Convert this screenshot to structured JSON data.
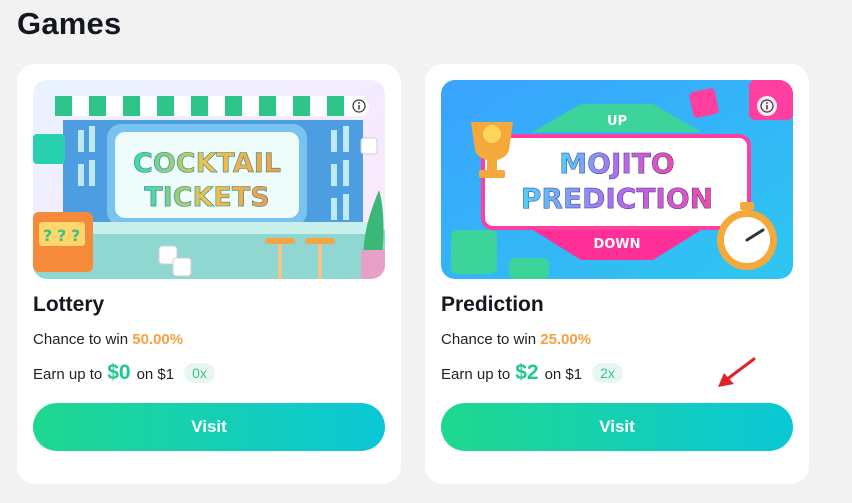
{
  "page": {
    "title": "Games"
  },
  "colors": {
    "accent_orange": "#f5a142",
    "accent_green": "#20c88c",
    "button_gradient_start": "#1fd88f",
    "button_gradient_end": "#0bc7d6",
    "annotation_arrow": "#e0232a"
  },
  "cards": [
    {
      "name": "Lottery",
      "banner_line1": "COCKTAIL",
      "banner_line2": "TICKETS",
      "chance_label": "Chance to win",
      "chance_value": "50.00%",
      "earn_label": "Earn up to",
      "earn_amount": "$0",
      "earn_on": "on $1",
      "multiplier": "0x",
      "button_label": "Visit",
      "info_icon": "info-icon"
    },
    {
      "name": "Prediction",
      "banner_line1": "MOJITO",
      "banner_line2": "PREDICTION",
      "banner_up": "UP",
      "banner_down": "DOWN",
      "chance_label": "Chance to win",
      "chance_value": "25.00%",
      "earn_label": "Earn up to",
      "earn_amount": "$2",
      "earn_on": "on $1",
      "multiplier": "2x",
      "button_label": "Visit",
      "info_icon": "info-icon"
    }
  ]
}
